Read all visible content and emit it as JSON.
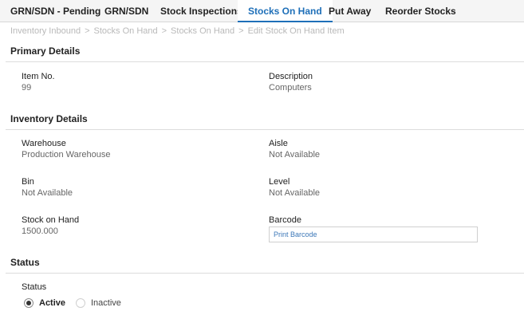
{
  "tabs": {
    "grn_pending": "GRN/SDN - Pending",
    "grn_sdn": "GRN/SDN",
    "stock_inspections": "Stock Inspections",
    "stocks_on_hand": "Stocks On Hand",
    "put_away": "Put Away",
    "reorder_stocks": "Reorder Stocks",
    "active": "Stocks On Hand"
  },
  "breadcrumb": {
    "items": [
      "Inventory Inbound",
      "Stocks On Hand",
      "Stocks On Hand",
      "Edit Stock On Hand Item"
    ],
    "separator": ">"
  },
  "primary": {
    "title": "Primary Details",
    "item_no_label": "Item No.",
    "item_no_value": "99",
    "description_label": "Description",
    "description_value": "Computers"
  },
  "inventory": {
    "title": "Inventory Details",
    "warehouse_label": "Warehouse",
    "warehouse_value": "Production Warehouse",
    "aisle_label": "Aisle",
    "aisle_value": "Not Available",
    "bin_label": "Bin",
    "bin_value": "Not Available",
    "level_label": "Level",
    "level_value": "Not Available",
    "stock_label": "Stock on Hand",
    "stock_value": "1500.000",
    "barcode_label": "Barcode",
    "barcode_link": "Print Barcode"
  },
  "status": {
    "title": "Status",
    "field_label": "Status",
    "options": [
      "Active",
      "Inactive"
    ],
    "selected": "Active"
  },
  "colors": {
    "accent": "#1e6fb8",
    "link": "#3d78b8",
    "muted": "#b9b9b9"
  }
}
